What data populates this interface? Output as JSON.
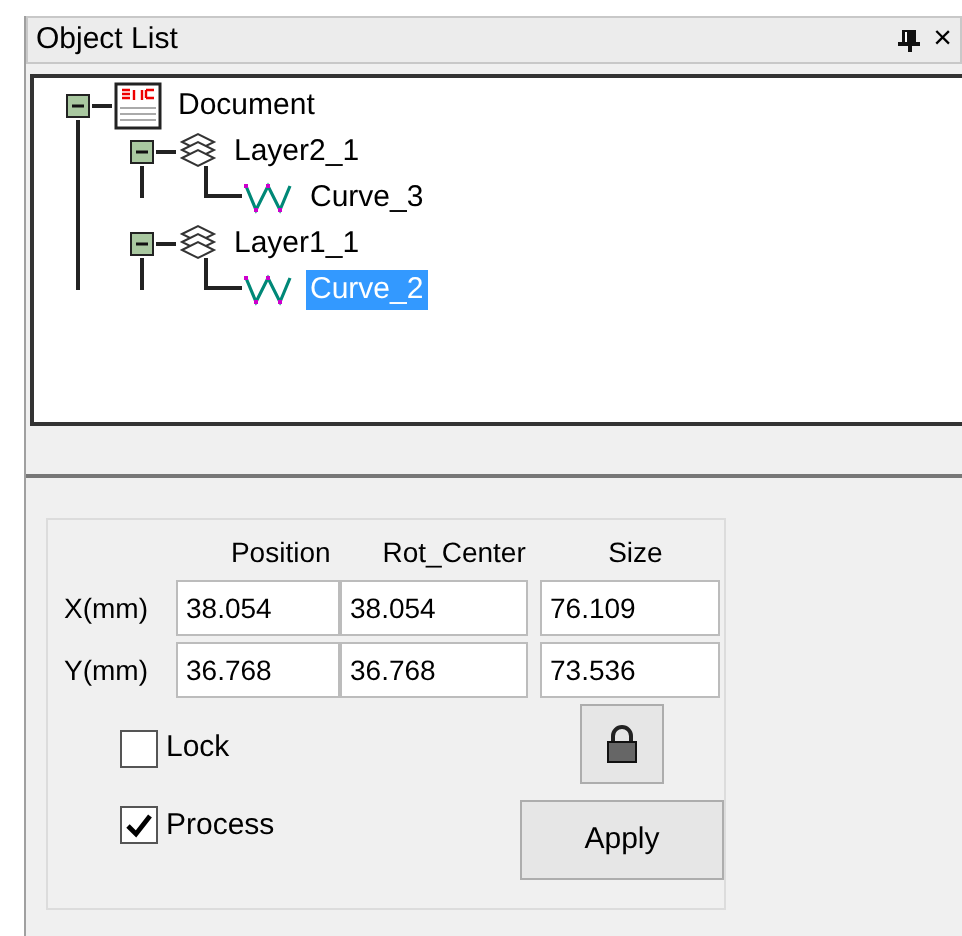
{
  "panel": {
    "title": "Object List",
    "close": "×"
  },
  "tree": [
    {
      "label": "Document",
      "kind": "document",
      "expanded": true,
      "selected": false,
      "children": [
        {
          "label": "Layer2_1",
          "kind": "layer",
          "expanded": true,
          "selected": false,
          "children": [
            {
              "label": "Curve_3",
              "kind": "curve",
              "selected": false
            }
          ]
        },
        {
          "label": "Layer1_1",
          "kind": "layer",
          "expanded": true,
          "selected": false,
          "children": [
            {
              "label": "Curve_2",
              "kind": "curve",
              "selected": true
            }
          ]
        }
      ]
    }
  ],
  "transform": {
    "columns": [
      "Position",
      "Rot_Center",
      "Size"
    ],
    "rows": [
      {
        "label": "X(mm)",
        "values": [
          "38.054",
          "38.054",
          "76.109"
        ]
      },
      {
        "label": "Y(mm)",
        "values": [
          "36.768",
          "36.768",
          "73.536"
        ]
      }
    ]
  },
  "options": [
    {
      "label": "Lock",
      "checked": false
    },
    {
      "label": "Process",
      "checked": true
    }
  ],
  "apply_button": "Apply"
}
